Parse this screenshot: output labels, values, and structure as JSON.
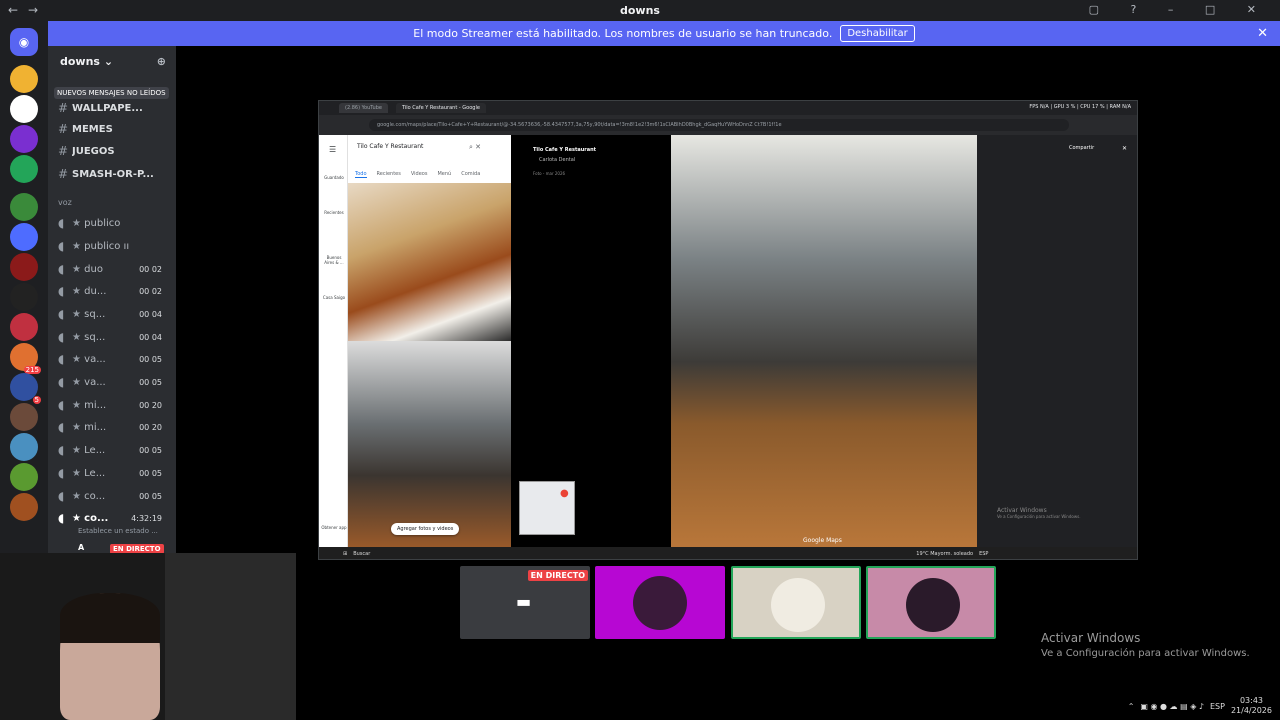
{
  "window": {
    "title": "downs"
  },
  "banner": {
    "message": "El modo Streamer está habilitado. Los nombres de usuario se han truncado.",
    "button": "Deshabilitar"
  },
  "server": {
    "name": "downs"
  },
  "tooltip": "NUEVOS MENSAJES NO LEÍDOS",
  "text_channels": [
    {
      "label": "WALLPAPE..."
    },
    {
      "label": "MEMES"
    },
    {
      "label": "JUEGOS"
    },
    {
      "label": "SMASH-OR-P..."
    }
  ],
  "voice_category": "voz",
  "voice_channels": [
    {
      "label": "publico",
      "count": ""
    },
    {
      "label": "publico ıı",
      "count": ""
    },
    {
      "label": "duo",
      "count": "00  02"
    },
    {
      "label": "du...",
      "count": "00  02"
    },
    {
      "label": "sq...",
      "count": "00  04"
    },
    {
      "label": "sq...",
      "count": "00  04"
    },
    {
      "label": "va...",
      "count": "00  05"
    },
    {
      "label": "va...",
      "count": "00  05"
    },
    {
      "label": "mi...",
      "count": "00  20"
    },
    {
      "label": "mi...",
      "count": "00  20"
    },
    {
      "label": "Le...",
      "count": "00  05"
    },
    {
      "label": "Le...",
      "count": "00  05"
    },
    {
      "label": "co...",
      "count": "00  05"
    },
    {
      "label": "co...",
      "count": "4:32:19"
    }
  ],
  "status_line": "Establece un estado ...",
  "voice_user": {
    "name": "A",
    "live": "EN DIRECTO"
  },
  "browser": {
    "tabs": [
      "(2.86) YouTube",
      "Tilo Cafe Y Restaurant - Google"
    ],
    "stats": "FPS  N/A   |   GPU  3 %   |   CPU  17 %   |   RAM  N/A",
    "url": "google.com/maps/place/Tilo+Cafe+Y+Restaurant/@-34.5673636,-58.4347577,3a,75y,90t/data=!3m8!1e2!3m6!1sCIABIhD0Bhgk_dGaqHuYWHoDnnZ Ct7B!1f!1e"
  },
  "maps": {
    "search_value": "Tilo Cafe Y Restaurant",
    "tabs": [
      "Todo",
      "Recientes",
      "Videos",
      "Menú",
      "Comida"
    ],
    "add_photos": "Agregar fotos y videos",
    "place_title": "Tilo Cafe Y Restaurant",
    "place_owner": "Carlota Dental",
    "photo_date": "Foto - mar 2026",
    "share": "Compartir",
    "google_maps": "Google Maps",
    "rail_items": [
      "Guardado",
      "Recientes",
      "Buenos Aires & ...",
      "Casa Saigo",
      "Obtener app"
    ],
    "activate_1": "Activar Windows",
    "activate_2": "Ve a Configuración para activar Windows."
  },
  "remote_taskbar": {
    "search": "Buscar",
    "weather": "19°C  Mayorm. soleado",
    "lang": "ESP"
  },
  "stream_tile": {
    "live": "EN DIRECTO"
  },
  "activate_windows": {
    "title": "Activar Windows",
    "subtitle": "Ve a Configuración para activar Windows."
  },
  "tray": {
    "lang": "ESP",
    "time": "03:43",
    "date": "21/4/2026"
  },
  "colors": {
    "accent": "#5865f2",
    "live": "#ed4245",
    "tile_purple": "#b707d3"
  }
}
